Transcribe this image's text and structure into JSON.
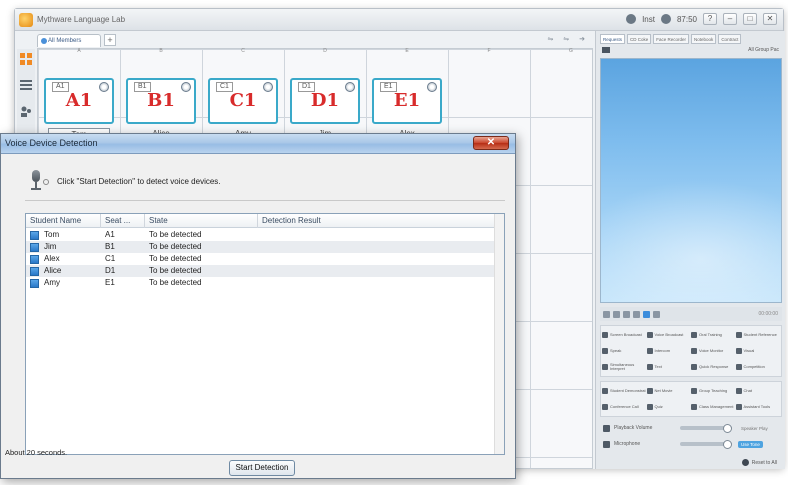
{
  "app": {
    "title": "Mythware Language Lab",
    "status_user": "Inst",
    "status_time": "87:50"
  },
  "seat_area": {
    "group_tab": "All Members",
    "add_tab": "+",
    "tools": "⇋ ⇋ ➜",
    "columns": [
      "A",
      "B",
      "C",
      "D",
      "E",
      "F",
      "G"
    ]
  },
  "seats": [
    {
      "label": "A1",
      "small": "A1",
      "name": "Tom",
      "selected": true
    },
    {
      "label": "B1",
      "small": "B1",
      "name": "Alice",
      "selected": false
    },
    {
      "label": "C1",
      "small": "C1",
      "name": "Amy",
      "selected": false
    },
    {
      "label": "D1",
      "small": "D1",
      "name": "Jim",
      "selected": false
    },
    {
      "label": "E1",
      "small": "E1",
      "name": "Alex",
      "selected": false
    }
  ],
  "right_panel": {
    "tabs": [
      "Requests",
      "CD Coke",
      "Face Recorder",
      "Notebook",
      "Contract"
    ],
    "sub_right": "All Group Pac",
    "play_time": "00:00:00",
    "functions_top": [
      "Screen Broadcast",
      "Voice Broadcast",
      "Oral Training",
      "Student Reference",
      "Speak",
      "Intercom",
      "Voice Monitor",
      "Visual",
      "Simultaneous Interpret",
      "Text",
      "Quick Response",
      "Competition"
    ],
    "functions_bottom": [
      "Student Demonstrat",
      "Net Movie",
      "Group Teaching",
      "Chat",
      "Conference Call",
      "Quiz",
      "Class Management",
      "Assistant Tools"
    ],
    "playback_label": "Playback Volume",
    "playback_extra": "Speaker Play",
    "mic_label": "Microphone",
    "mic_extra": "Use Tone",
    "reset_all": "Reset to All"
  },
  "dialog": {
    "title": "Voice Device Detection",
    "close": "✕",
    "hint": "Click \"Start Detection\" to detect voice devices.",
    "columns": [
      "Student Name",
      "Seat ...",
      "State",
      "Detection Result"
    ],
    "rows": [
      {
        "name": "Tom",
        "seat": "A1",
        "state": "To be detected",
        "result": ""
      },
      {
        "name": "Jim",
        "seat": "B1",
        "state": "To be detected",
        "result": ""
      },
      {
        "name": "Alex",
        "seat": "C1",
        "state": "To be detected",
        "result": ""
      },
      {
        "name": "Alice",
        "seat": "D1",
        "state": "To be detected",
        "result": ""
      },
      {
        "name": "Amy",
        "seat": "E1",
        "state": "To be detected",
        "result": ""
      }
    ],
    "status": "About 20 seconds.",
    "start_button": "Start Detection"
  },
  "colors": {
    "seat_border": "#3aa9c9",
    "seat_label": "#d82b2b",
    "close_button": "#c9452c",
    "row_icon": "#2a78c8"
  }
}
